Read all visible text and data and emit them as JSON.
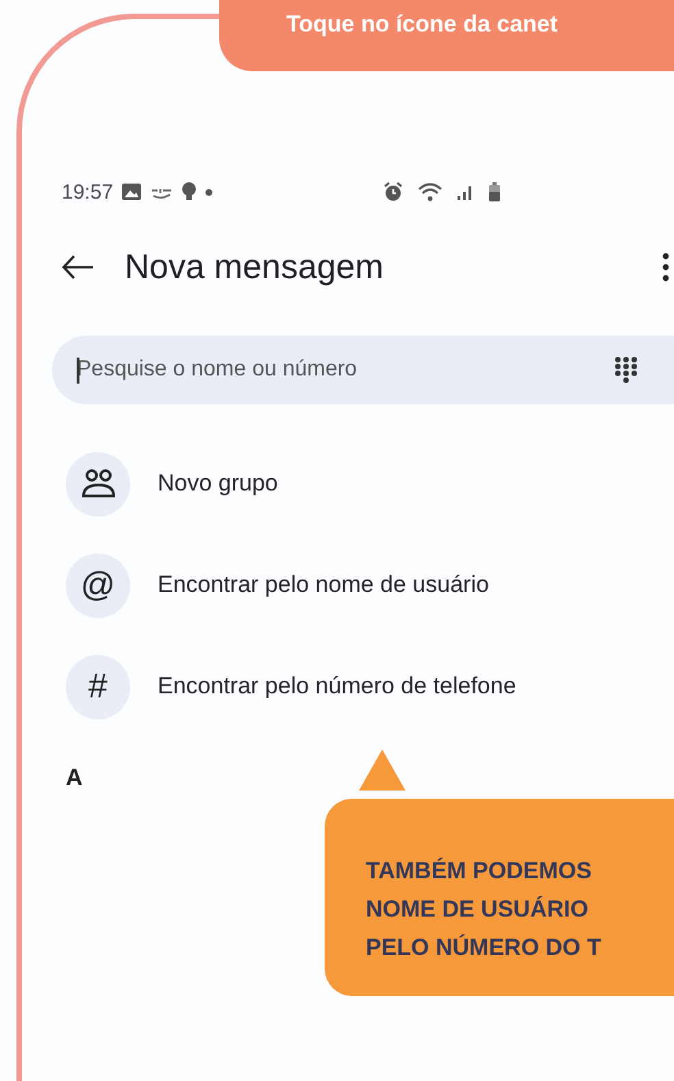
{
  "tip_banner": {
    "text": "Toque no ícone da canet"
  },
  "status_bar": {
    "time": "19:57"
  },
  "header": {
    "title": "Nova mensagem"
  },
  "search": {
    "placeholder": "Pesquise o nome ou número"
  },
  "actions": [
    {
      "kind": "group",
      "label": "Novo grupo"
    },
    {
      "kind": "glyph",
      "glyph": "@",
      "label": "Encontrar pelo nome de usuário"
    },
    {
      "kind": "glyph",
      "glyph": "#",
      "label": "Encontrar pelo número de telefone"
    }
  ],
  "section_letter": "A",
  "callout": {
    "lines": [
      "TAMBÉM PODEMOS",
      "NOME DE USUÁRIO",
      "PELO NÚMERO DO T"
    ]
  }
}
